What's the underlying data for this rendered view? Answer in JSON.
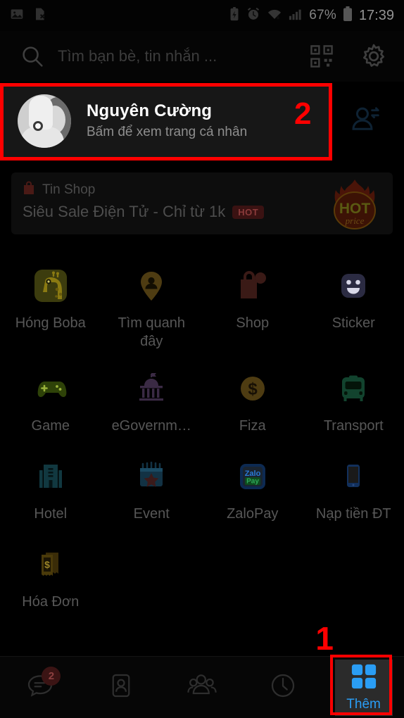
{
  "statusbar": {
    "left_icons": [
      "image-icon",
      "sim-card-off-icon"
    ],
    "right_icons": [
      "battery-saver-icon",
      "alarm-icon",
      "wifi-icon",
      "signal-icon"
    ],
    "battery_percent": "67%",
    "clock": "17:39"
  },
  "search": {
    "placeholder": "Tìm bạn bè, tin nhắn ...",
    "qr_icon": "qr-code-icon",
    "settings_icon": "gear-icon"
  },
  "profile": {
    "name": "Nguyên Cường",
    "subtitle": "Bấm để xem trang cá nhân",
    "avatar_icon": "user-avatar-photo",
    "action_icon": "person-sync-icon"
  },
  "promo": {
    "kicker": "Tin Shop",
    "kicker_icon": "shopping-bag-icon",
    "title": "Siêu Sale Điện Tử - Chỉ từ 1k",
    "badge": "HOT",
    "art_text_top": "HOT",
    "art_text_bottom": "price"
  },
  "apps": [
    {
      "label": "Hóng Boba",
      "icon": "giraffe-icon",
      "color": "#3a3a10"
    },
    {
      "label": "Tìm quanh đây",
      "icon": "location-person-icon",
      "color": "#4a3a14"
    },
    {
      "label": "Shop",
      "icon": "shopping-bag-icon",
      "color": "#3a1a16"
    },
    {
      "label": "Sticker",
      "icon": "smiley-face-icon",
      "color": "#2a2a3e"
    },
    {
      "label": "Game",
      "icon": "gamepad-icon",
      "color": "#2a3a10"
    },
    {
      "label": "eGovernm…",
      "icon": "government-icon",
      "color": "#2e1e34"
    },
    {
      "label": "Fiza",
      "icon": "dollar-coin-icon",
      "color": "#4a3a12"
    },
    {
      "label": "Transport",
      "icon": "bus-icon",
      "color": "#12402c"
    },
    {
      "label": "Hotel",
      "icon": "hotel-building-icon",
      "color": "#12343a"
    },
    {
      "label": "Event",
      "icon": "calendar-star-icon",
      "color": "#13303e"
    },
    {
      "label": "ZaloPay",
      "icon": "zalopay-logo-icon",
      "color": "#12305c"
    },
    {
      "label": "Nạp tiền ĐT",
      "icon": "mobile-phone-icon",
      "color": "#12305c"
    },
    {
      "label": "Hóa Đơn",
      "icon": "invoice-icon",
      "color": "#44330a"
    }
  ],
  "bottom_nav": [
    {
      "label": "",
      "icon": "chat-bubble-icon",
      "badge": "2"
    },
    {
      "label": "",
      "icon": "contact-card-icon",
      "badge": ""
    },
    {
      "label": "",
      "icon": "group-people-icon",
      "badge": ""
    },
    {
      "label": "",
      "icon": "clock-icon",
      "badge": ""
    }
  ],
  "more_tab": {
    "label": "Thêm",
    "icon": "grid-four-squares-icon",
    "accent": "#2a9df4"
  },
  "annotations": {
    "marker_one": "1",
    "marker_two": "2",
    "color": "#ff0000"
  }
}
